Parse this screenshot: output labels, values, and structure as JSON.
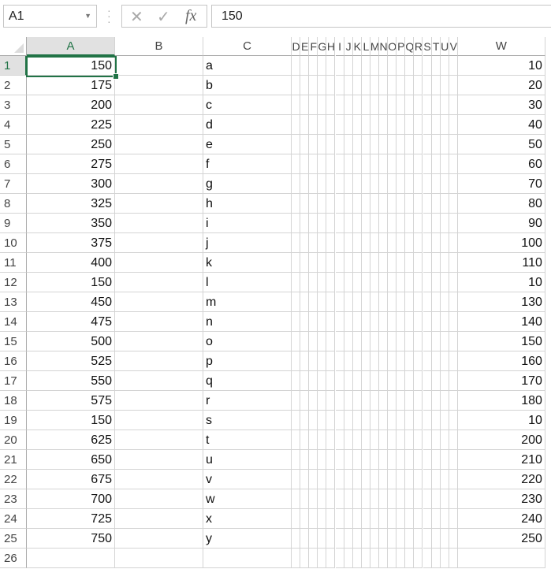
{
  "name_box": "A1",
  "formula_bar": {
    "cancel_icon": "x-icon",
    "enter_icon": "check-icon",
    "fx_label": "fx",
    "value": "150"
  },
  "columns": [
    "A",
    "B",
    "C",
    "D",
    "E",
    "F",
    "G",
    "H",
    "I",
    "J",
    "K",
    "L",
    "M",
    "N",
    "O",
    "P",
    "Q",
    "R",
    "S",
    "T",
    "U",
    "V",
    "W"
  ],
  "active_cell": "A1",
  "rows": [
    {
      "n": "1",
      "A": "150",
      "C": "a",
      "W": "10"
    },
    {
      "n": "2",
      "A": "175",
      "C": "b",
      "W": "20"
    },
    {
      "n": "3",
      "A": "200",
      "C": "c",
      "W": "30"
    },
    {
      "n": "4",
      "A": "225",
      "C": "d",
      "W": "40"
    },
    {
      "n": "5",
      "A": "250",
      "C": "e",
      "W": "50"
    },
    {
      "n": "6",
      "A": "275",
      "C": "f",
      "W": "60"
    },
    {
      "n": "7",
      "A": "300",
      "C": "g",
      "W": "70"
    },
    {
      "n": "8",
      "A": "325",
      "C": "h",
      "W": "80"
    },
    {
      "n": "9",
      "A": "350",
      "C": "i",
      "W": "90"
    },
    {
      "n": "10",
      "A": "375",
      "C": "j",
      "W": "100"
    },
    {
      "n": "11",
      "A": "400",
      "C": "k",
      "W": "110"
    },
    {
      "n": "12",
      "A": "150",
      "C": "l",
      "W": "10"
    },
    {
      "n": "13",
      "A": "450",
      "C": "m",
      "W": "130"
    },
    {
      "n": "14",
      "A": "475",
      "C": "n",
      "W": "140"
    },
    {
      "n": "15",
      "A": "500",
      "C": "o",
      "W": "150"
    },
    {
      "n": "16",
      "A": "525",
      "C": "p",
      "W": "160"
    },
    {
      "n": "17",
      "A": "550",
      "C": "q",
      "W": "170"
    },
    {
      "n": "18",
      "A": "575",
      "C": "r",
      "W": "180"
    },
    {
      "n": "19",
      "A": "150",
      "C": "s",
      "W": "10"
    },
    {
      "n": "20",
      "A": "625",
      "C": "t",
      "W": "200"
    },
    {
      "n": "21",
      "A": "650",
      "C": "u",
      "W": "210"
    },
    {
      "n": "22",
      "A": "675",
      "C": "v",
      "W": "220"
    },
    {
      "n": "23",
      "A": "700",
      "C": "w",
      "W": "230"
    },
    {
      "n": "24",
      "A": "725",
      "C": "x",
      "W": "240"
    },
    {
      "n": "25",
      "A": "750",
      "C": "y",
      "W": "250"
    },
    {
      "n": "26",
      "A": "",
      "C": "",
      "W": ""
    }
  ]
}
